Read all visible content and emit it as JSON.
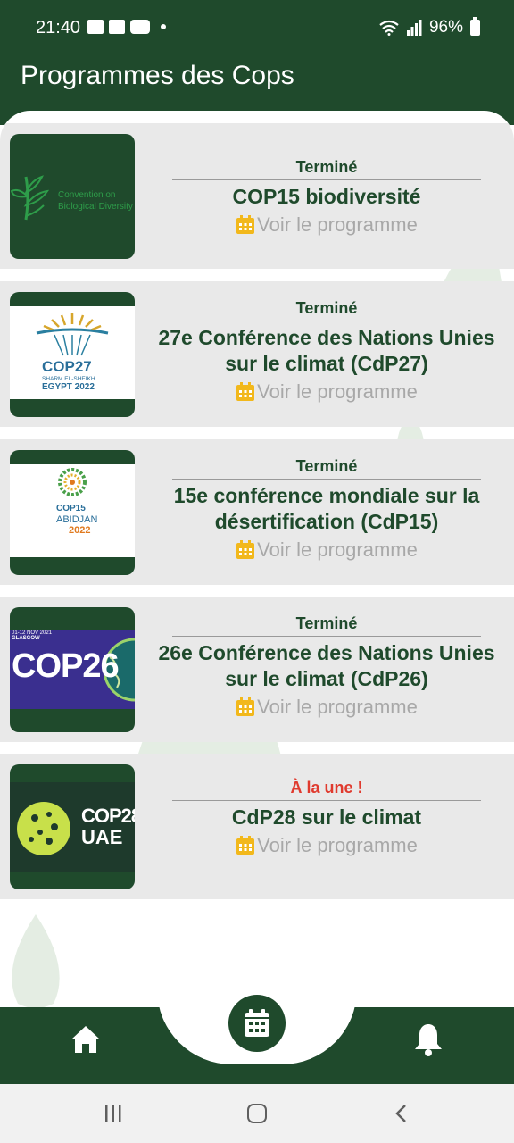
{
  "status_bar": {
    "time": "21:40",
    "battery": "96%"
  },
  "app_bar": {
    "title": "Programmes des Cops"
  },
  "cards": [
    {
      "status": "Terminé",
      "title_lines": [
        "COP15 biodiversité"
      ],
      "link": "Voir le programme",
      "logo_lines": [
        "Convention on",
        "Biological Diversity"
      ]
    },
    {
      "status": "Terminé",
      "title_lines": [
        "27e Conférence des Nations Unies",
        "sur le climat (CdP27)"
      ],
      "link": "Voir le programme",
      "logo_lines": [
        "COP27",
        "SHARM EL-SHEIKH",
        "EGYPT 2022"
      ]
    },
    {
      "status": "Terminé",
      "title_lines": [
        "15e conférence mondiale sur la",
        "désertification (CdP15)"
      ],
      "link": "Voir le programme",
      "logo_lines": [
        "COP15",
        "ABIDJAN",
        "2022"
      ]
    },
    {
      "status": "Terminé",
      "title_lines": [
        "26e Conférence des Nations Unies",
        "sur le climat (CdP26)"
      ],
      "link": "Voir le programme",
      "logo_lines": [
        "01-12 NOV 2021",
        "GLASGOW",
        "COP26"
      ]
    },
    {
      "status": "À la une !",
      "title_lines": [
        "CdP28 sur le climat"
      ],
      "link": "Voir le programme",
      "logo_lines": [
        "COP28",
        "UAE"
      ]
    }
  ],
  "colors": {
    "primary": "#1f4a2c",
    "status_terminated": "#1f4a2c",
    "status_featured": "#e03a2e",
    "link": "#a8a8a8",
    "calendar": "#f2b81b",
    "card_bg": "#e9e9e9"
  },
  "nav": {
    "items": [
      "home-icon",
      "calendar-icon",
      "bell-icon"
    ]
  }
}
